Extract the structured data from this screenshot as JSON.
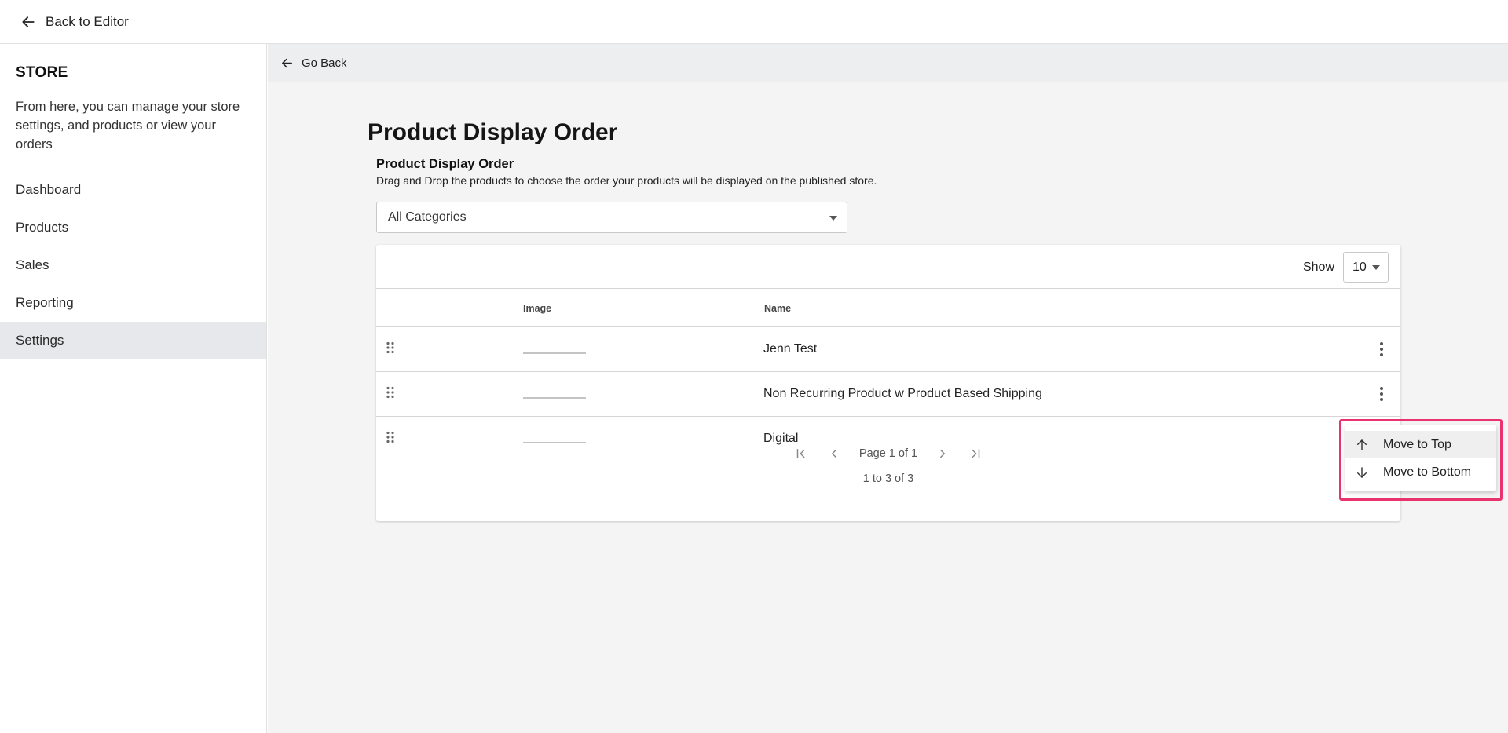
{
  "topbar": {
    "back_label": "Back to Editor"
  },
  "sidebar": {
    "title": "STORE",
    "description": "From here, you can manage your store settings, and products or view your orders",
    "items": [
      {
        "label": "Dashboard",
        "active": false
      },
      {
        "label": "Products",
        "active": false
      },
      {
        "label": "Sales",
        "active": false
      },
      {
        "label": "Reporting",
        "active": false
      },
      {
        "label": "Settings",
        "active": true
      }
    ]
  },
  "subbar": {
    "go_back_label": "Go Back"
  },
  "page": {
    "title": "Product Display Order",
    "section_title": "Product Display Order",
    "section_description": "Drag and Drop the products to choose the order your products will be displayed on the published store.",
    "category_filter": "All Categories"
  },
  "table": {
    "show_label": "Show",
    "page_size": "10",
    "columns": {
      "image": "Image",
      "name": "Name"
    },
    "rows": [
      {
        "name": "Jenn Test"
      },
      {
        "name": "Non Recurring Product w Product Based Shipping"
      },
      {
        "name": "Digital"
      }
    ],
    "pagination": {
      "page_label": "Page 1 of 1",
      "range_label": "1 to 3 of 3"
    }
  },
  "context_menu": {
    "items": [
      {
        "label": "Move to Top",
        "icon": "arrow-up-icon"
      },
      {
        "label": "Move to Bottom",
        "icon": "arrow-down-icon"
      }
    ],
    "highlight_color": "#e8336e"
  }
}
